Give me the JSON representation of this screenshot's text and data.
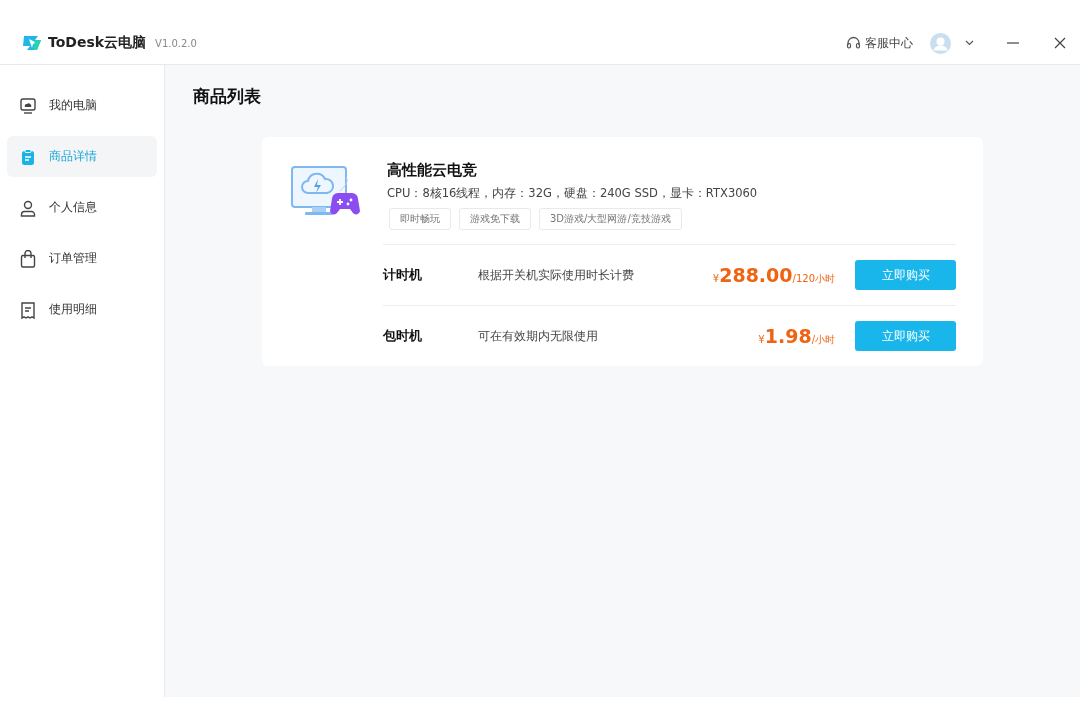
{
  "window": {
    "app_name": "ToDesk云电脑",
    "version": "V1.0.2.0",
    "support": "客服中心"
  },
  "sidebar": {
    "items": [
      {
        "label": "我的电脑",
        "kind": "monitor",
        "selected": false
      },
      {
        "label": "商品详情",
        "kind": "clipboard",
        "selected": true
      },
      {
        "label": "个人信息",
        "kind": "person",
        "selected": false
      },
      {
        "label": "订单管理",
        "kind": "bag",
        "selected": false
      },
      {
        "label": "使用明细",
        "kind": "receipt",
        "selected": false
      }
    ]
  },
  "page_title": "商品列表",
  "product": {
    "name": "高性能云电竞",
    "specs": "CPU：8核16线程，内存：32G，硬盘：240G SSD，显卡：RTX3060",
    "tags": [
      "即时畅玩",
      "游戏免下载",
      "3D游戏/大型网游/竞技游戏"
    ],
    "plans": [
      {
        "name": "计时机",
        "description": "根据开关机实际使用时长计费",
        "currency": "¥",
        "price": "288.00",
        "unit": "/120小时",
        "button": "立即购买"
      },
      {
        "name": "包时机",
        "description": "可在有效期内无限使用",
        "currency": "¥",
        "price": "1.98",
        "unit": "/小时",
        "button": "立即购买"
      }
    ]
  }
}
